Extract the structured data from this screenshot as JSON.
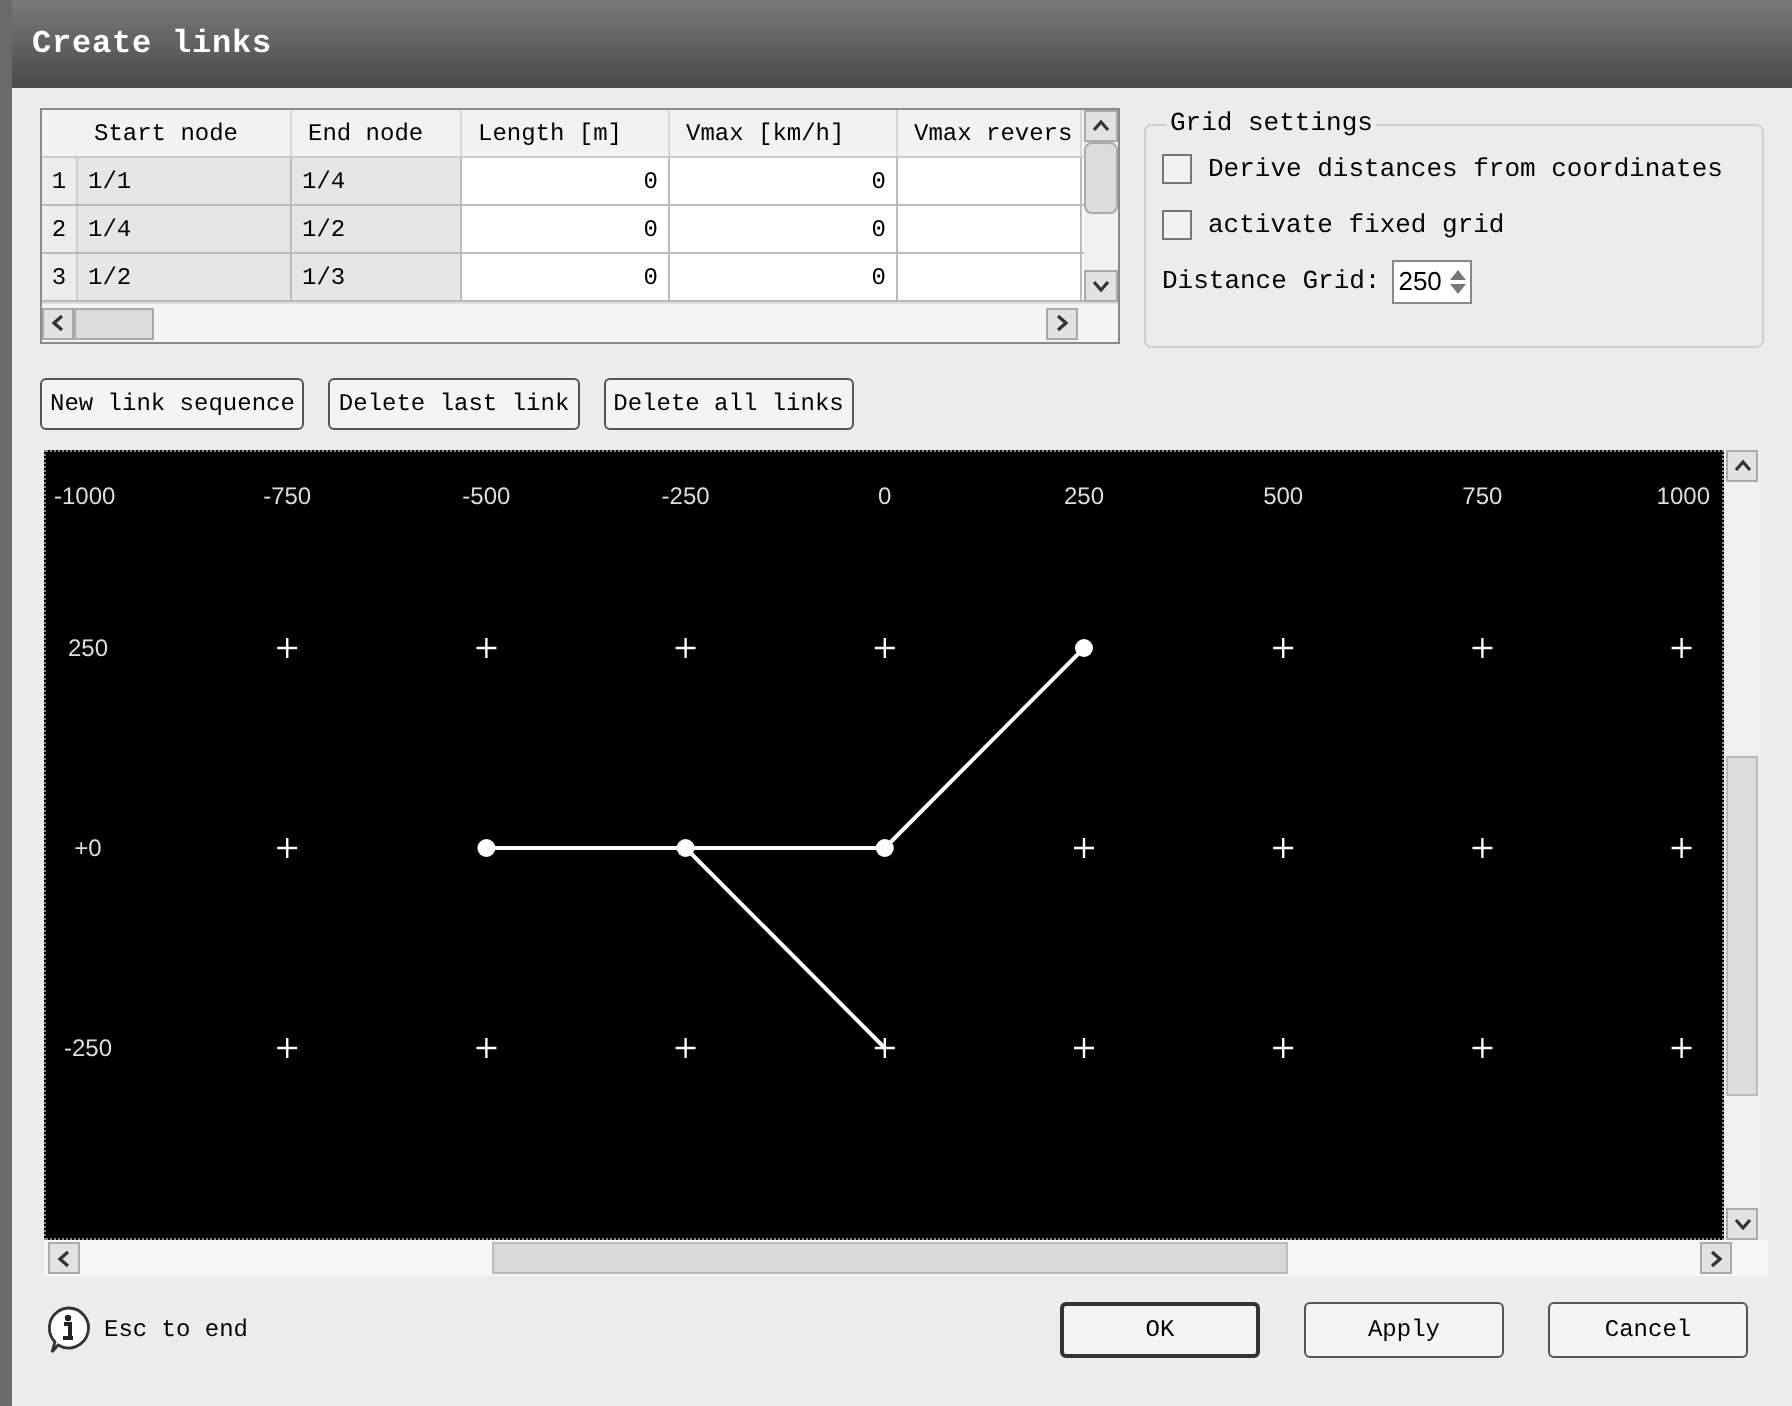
{
  "window": {
    "title": "Create links"
  },
  "table": {
    "columns": [
      "Start node",
      "End node",
      "Length [m]",
      "Vmax [km/h]",
      "Vmax revers"
    ],
    "rows": [
      {
        "index": "1",
        "cells": [
          "1/1",
          "1/4",
          "0",
          "0",
          ""
        ]
      },
      {
        "index": "2",
        "cells": [
          "1/4",
          "1/2",
          "0",
          "0",
          ""
        ]
      },
      {
        "index": "3",
        "cells": [
          "1/2",
          "1/3",
          "0",
          "0",
          ""
        ]
      }
    ]
  },
  "grid_settings": {
    "title": "Grid settings",
    "options": [
      {
        "label": "Derive distances from coordinates",
        "checked": false
      },
      {
        "label": "activate fixed grid",
        "checked": false
      }
    ],
    "distance_label": "Distance Grid:",
    "distance_value": "250"
  },
  "actions": [
    "New link sequence",
    "Delete last link",
    "Delete all links"
  ],
  "canvas": {
    "x_labels": [
      "-1000",
      "-750",
      "-500",
      "-250",
      "0",
      "250",
      "500",
      "750",
      "1000"
    ],
    "y_labels": [
      "250",
      "+0",
      "-250"
    ]
  },
  "footer": {
    "hint": "Esc to end",
    "buttons": [
      {
        "label": "OK",
        "kind": "default"
      },
      {
        "label": "Apply",
        "kind": "normal"
      },
      {
        "label": "Cancel",
        "kind": "normal"
      }
    ]
  }
}
